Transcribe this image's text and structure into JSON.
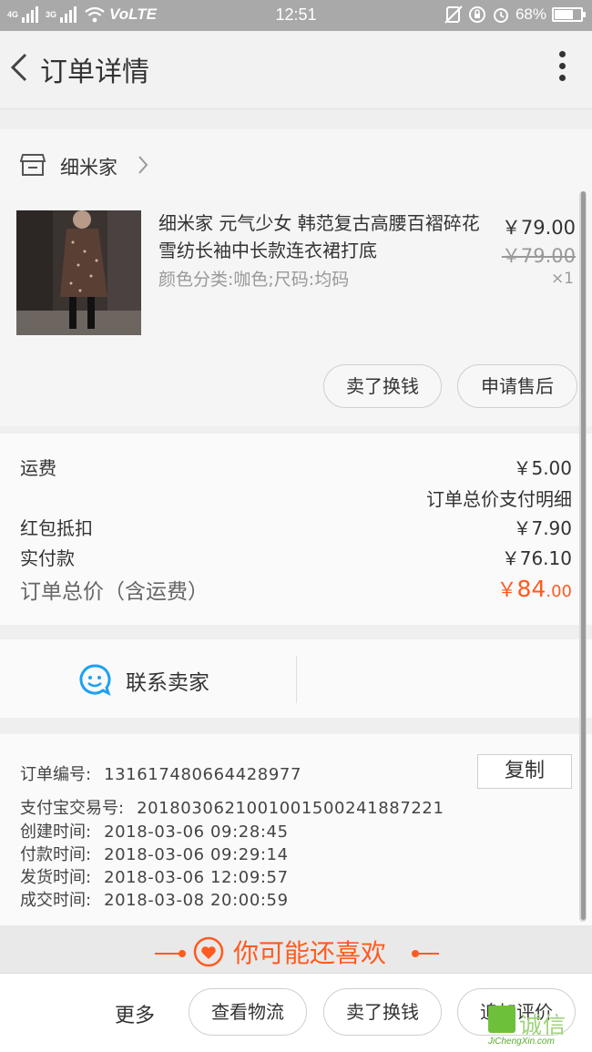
{
  "status_bar": {
    "left_signal_a": "4G",
    "left_signal_b": "3G",
    "volte": "VoLTE",
    "time": "12:51",
    "battery": "68%"
  },
  "nav": {
    "title": "订单详情"
  },
  "shop": {
    "name": "细米家"
  },
  "product": {
    "title": "细米家 元气少女 韩范复古高腰百褶碎花雪纺长袖中长款连衣裙打底",
    "sku": "颜色分类:咖色;尺码:均码",
    "price": "￥79.00",
    "original_price": "￥79.00",
    "quantity": "×1",
    "actions": [
      "卖了换钱",
      "申请售后"
    ]
  },
  "fees": {
    "shipping_label": "运费",
    "shipping_value": "￥5.00",
    "detail_link": "订单总价支付明细",
    "redpacket_label": "红包抵扣",
    "redpacket_value": "￥7.90",
    "paid_label": "实付款",
    "paid_value": "￥76.10",
    "total_label": "订单总价（含运费）",
    "total_currency": "￥",
    "total_int": "84",
    "total_dec": ".00"
  },
  "contact": {
    "label": "联系卖家"
  },
  "order_info": {
    "copy_label": "复制",
    "rows": [
      {
        "label": "订单编号:",
        "value": "1316174806644289​77"
      },
      {
        "label": "支付宝交易号:",
        "value": "2018030621001001500241887221"
      },
      {
        "label": "创建时间:",
        "value": "2018-03-06 09:28:45"
      },
      {
        "label": "付款时间:",
        "value": "2018-03-06 09:29:14"
      },
      {
        "label": "发货时间:",
        "value": "2018-03-06 12:09:57"
      },
      {
        "label": "成交时间:",
        "value": "2018-03-08 20:00:59"
      }
    ]
  },
  "recommend": {
    "title": "你可能还喜欢"
  },
  "bottom_bar": {
    "more": "更多",
    "buttons": [
      "查看物流",
      "卖了换钱",
      "追加评价"
    ]
  },
  "watermark": {
    "text": "诚信",
    "sub": "JiChengXin.com"
  },
  "colors": {
    "accent": "#ff5a1f",
    "contact_blue": "#1da1f2"
  }
}
